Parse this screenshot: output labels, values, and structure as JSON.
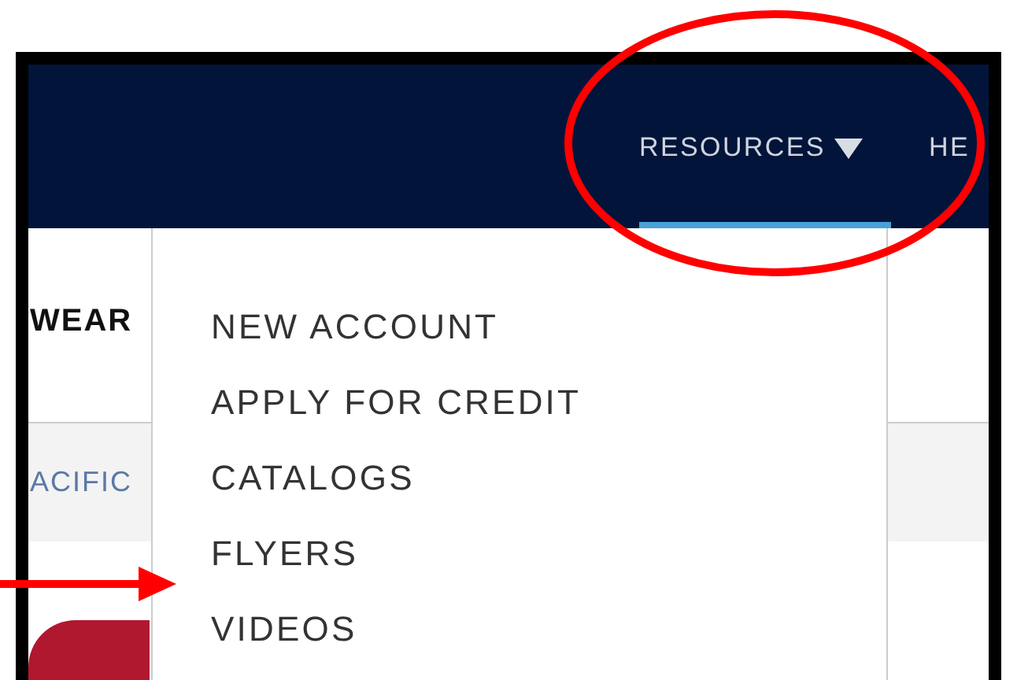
{
  "header": {
    "nav": [
      {
        "label": "RESOURCES",
        "selected": true,
        "expanded": true
      },
      {
        "label": "HE",
        "selected": false,
        "expanded": false
      }
    ]
  },
  "category_bar": {
    "label": "WEAR"
  },
  "sub_bar": {
    "label": "ACIFIC"
  },
  "dropdown": {
    "items": [
      {
        "label": "NEW ACCOUNT"
      },
      {
        "label": "APPLY FOR CREDIT"
      },
      {
        "label": "CATALOGS"
      },
      {
        "label": "FLYERS"
      },
      {
        "label": "VIDEOS"
      }
    ]
  }
}
